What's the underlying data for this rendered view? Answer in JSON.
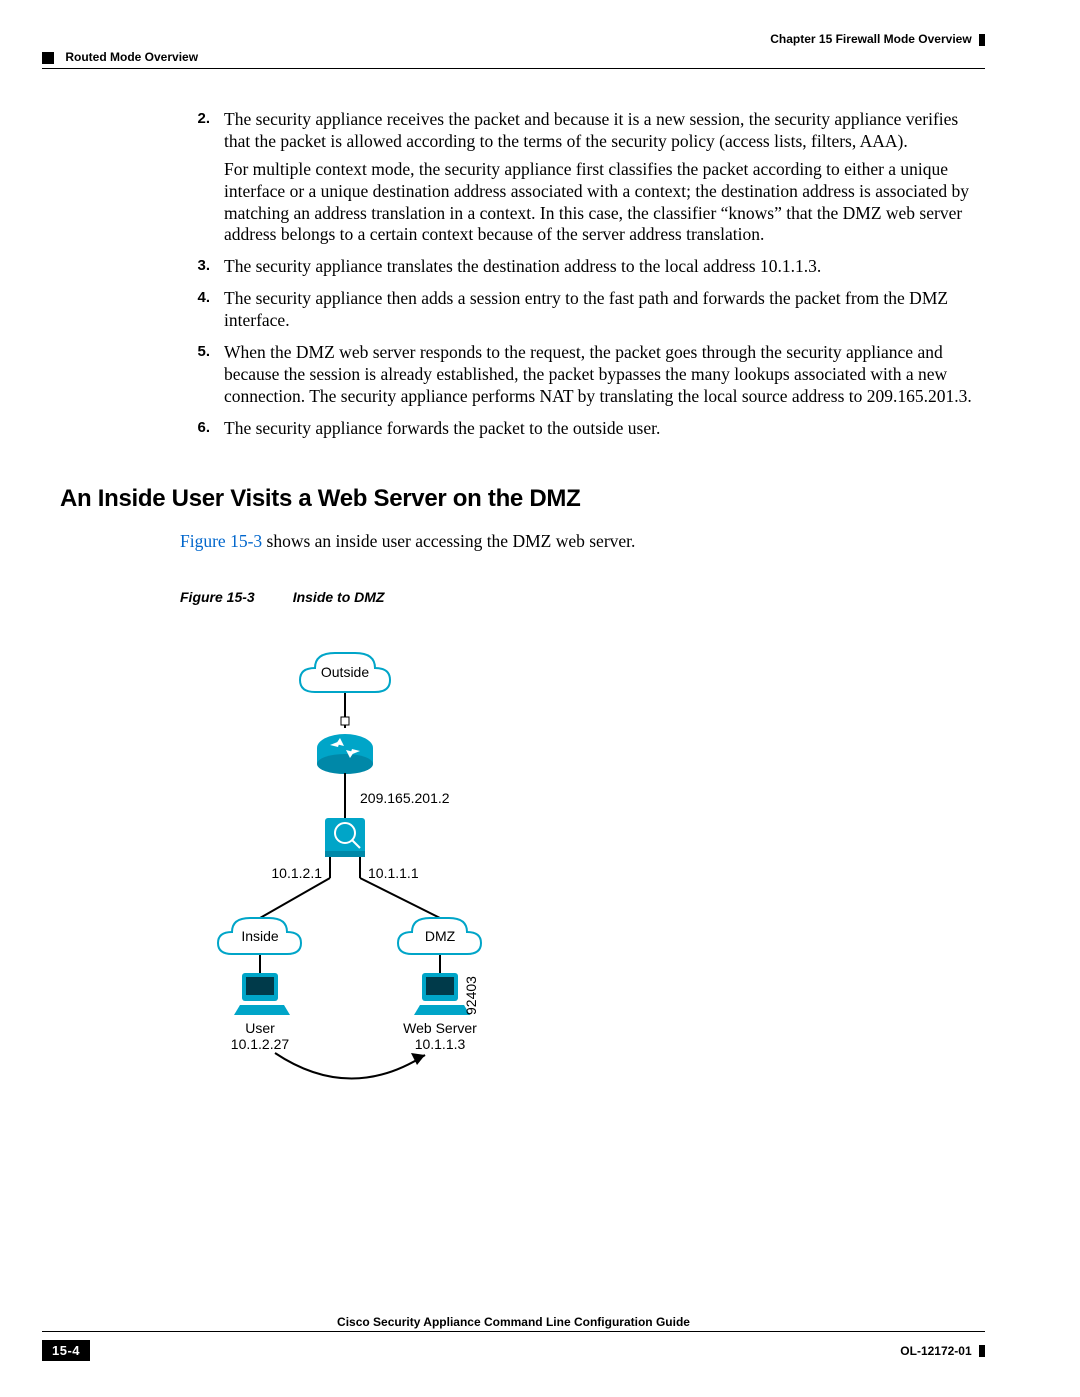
{
  "header": {
    "chapter": "Chapter 15    Firewall Mode Overview",
    "section": "Routed Mode Overview"
  },
  "steps": [
    {
      "num": "2.",
      "paras": [
        "The security appliance receives the packet and because it is a new session, the security appliance verifies that the packet is allowed according to the terms of the security policy (access lists, filters, AAA).",
        "For multiple context mode, the security appliance first classifies the packet according to either a unique interface or a unique destination address associated with a context; the destination address is associated by matching an address translation in a context. In this case, the classifier “knows” that the DMZ web server address belongs to a certain context because of the server address translation."
      ]
    },
    {
      "num": "3.",
      "paras": [
        "The security appliance translates the destination address to the local address 10.1.1.3."
      ]
    },
    {
      "num": "4.",
      "paras": [
        "The security appliance then adds a session entry to the fast path and forwards the packet from the DMZ interface."
      ]
    },
    {
      "num": "5.",
      "paras": [
        "When the DMZ web server responds to the request, the packet goes through the security appliance and because the session is already established, the packet bypasses the many lookups associated with a new connection. The security appliance performs NAT by translating the local source address to 209.165.201.3."
      ]
    },
    {
      "num": "6.",
      "paras": [
        "The security appliance forwards the packet to the outside user."
      ]
    }
  ],
  "heading": "An Inside User Visits a Web Server on the DMZ",
  "intro_prefix": "Figure 15-3",
  "intro_suffix": " shows an inside user accessing the DMZ web server.",
  "figure": {
    "label": "Figure 15-3",
    "title": "Inside to DMZ",
    "labels": {
      "outside": "Outside",
      "outside_ip": "209.165.201.2",
      "left_if": "10.1.2.1",
      "right_if": "10.1.1.1",
      "inside": "Inside",
      "dmz": "DMZ",
      "user": "User",
      "user_ip": "10.1.2.27",
      "server": "Web Server",
      "server_ip": "10.1.1.3",
      "code": "92403"
    }
  },
  "footer": {
    "title": "Cisco Security Appliance Command Line Configuration Guide",
    "page": "15-4",
    "doc": "OL-12172-01"
  }
}
